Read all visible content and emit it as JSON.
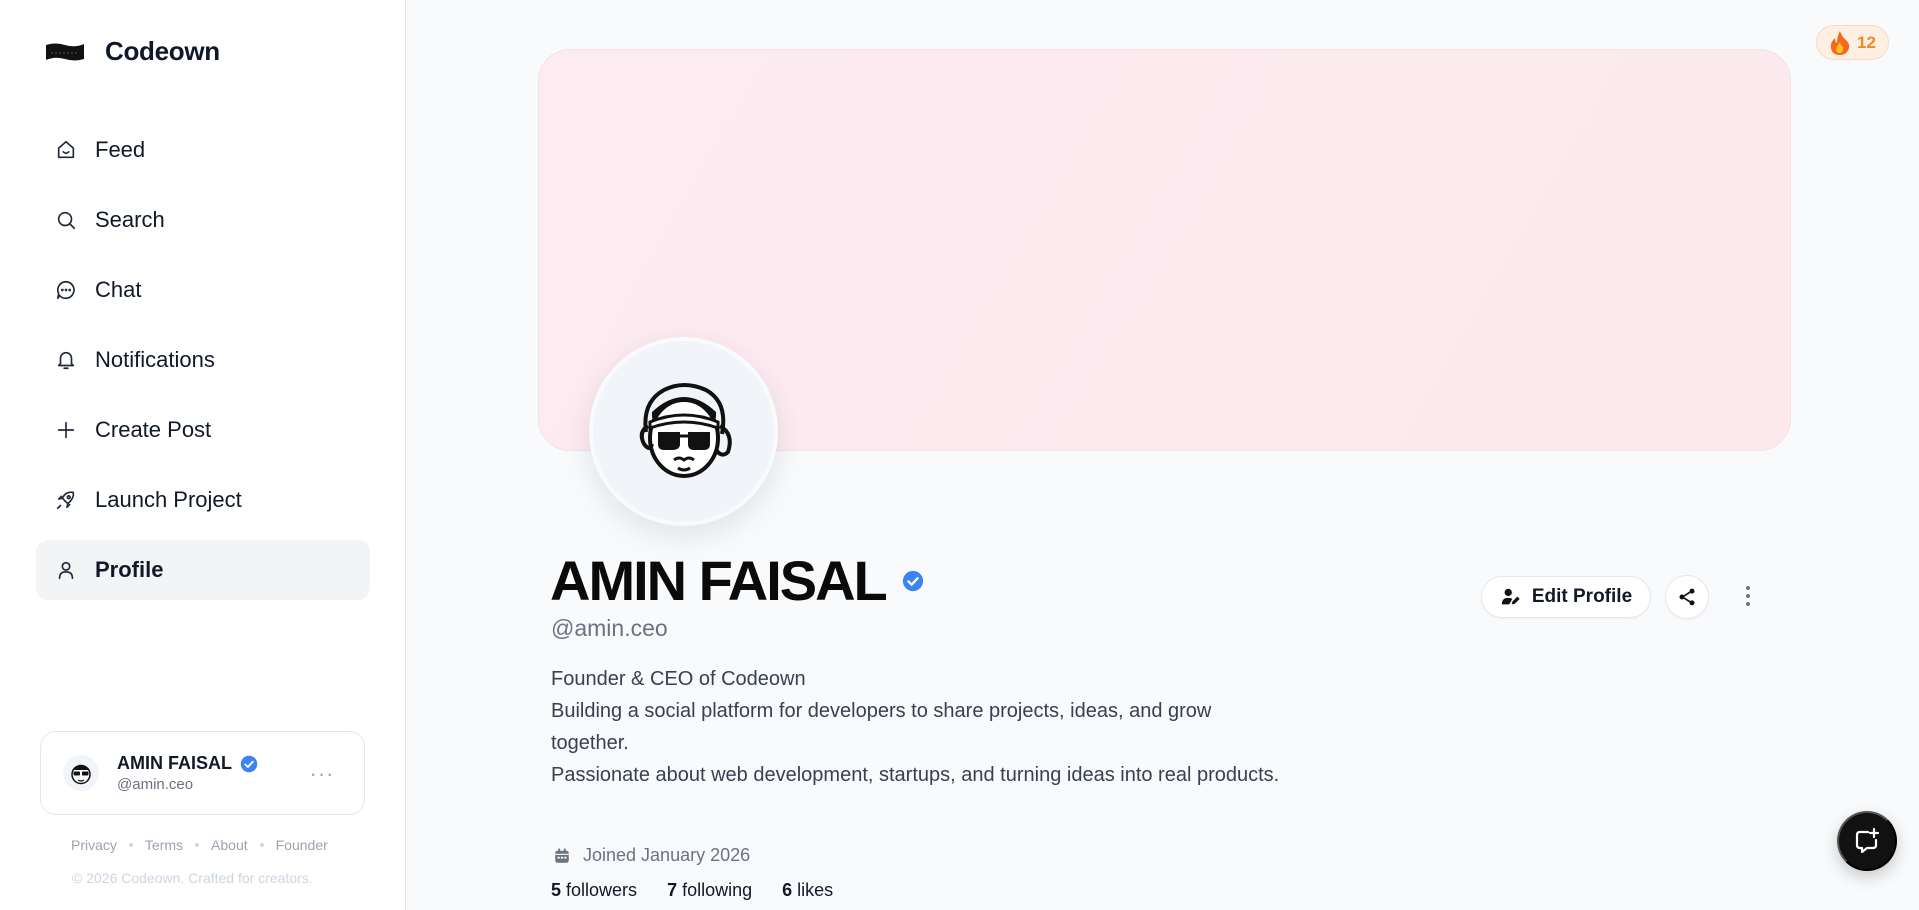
{
  "brand": {
    "name": "Codeown"
  },
  "nav": {
    "items": [
      {
        "label": "Feed",
        "icon": "home-icon"
      },
      {
        "label": "Search",
        "icon": "search-icon"
      },
      {
        "label": "Chat",
        "icon": "chat-icon"
      },
      {
        "label": "Notifications",
        "icon": "bell-icon"
      },
      {
        "label": "Create Post",
        "icon": "plus-icon"
      },
      {
        "label": "Launch Project",
        "icon": "rocket-icon"
      },
      {
        "label": "Profile",
        "icon": "user-icon",
        "active": true
      }
    ]
  },
  "user_card": {
    "name": "AMIN FAISAL",
    "handle": "@amin.ceo",
    "more": "···"
  },
  "footer": {
    "links": [
      "Privacy",
      "Terms",
      "About",
      "Founder"
    ],
    "copyright": "© 2026 Codeown. Crafted for creators."
  },
  "profile": {
    "name": "AMIN FAISAL",
    "handle": "@amin.ceo",
    "bio": [
      "Founder & CEO of Codeown",
      "Building a social platform for developers to share projects, ideas, and grow together.",
      "Passionate about web development, startups, and turning ideas into real products."
    ],
    "joined": "Joined January 2026",
    "stats": {
      "followers_count": "5",
      "followers_label": "followers",
      "following_count": "7",
      "following_label": "following",
      "likes_count": "6",
      "likes_label": "likes"
    },
    "edit_label": "Edit Profile"
  },
  "streak": {
    "count": "12"
  },
  "colors": {
    "verified": "#3b82f6",
    "streak": "#ea8a2b",
    "cover": "#fdebf2"
  }
}
